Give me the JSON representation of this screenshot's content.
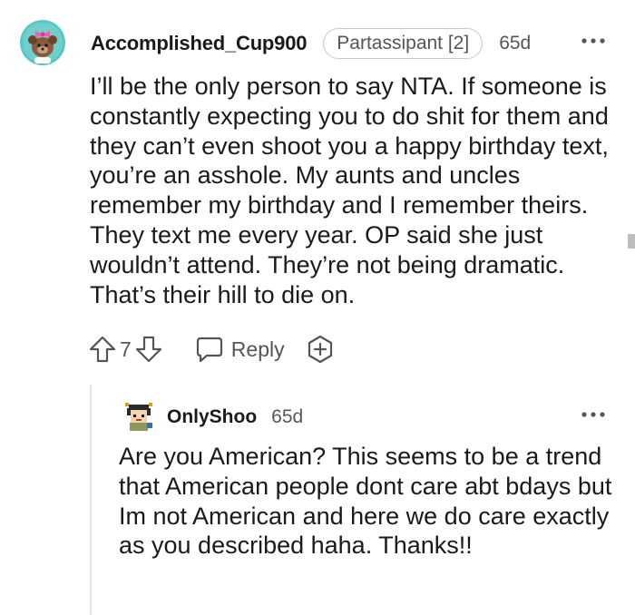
{
  "comment": {
    "username": "Accomplished_Cup900",
    "flair": "Partassipant [2]",
    "age": "65d",
    "avatar_icon": "avatar-pink-bow-icon",
    "body": "I’ll be the only person to say NTA. If someone is constantly expecting you to do shit for them and they can’t even shoot you a happy birthday text, you’re an asshole. My aunts and uncles remember my birthday and I remember theirs. They text me every year. OP said she just wouldn’t attend. They’re not being dramatic. That’s their hill to die on.",
    "vote_count": "7",
    "reply_label": "Reply",
    "more_icon": "more-options-icon"
  },
  "reply": {
    "username": "OnlyShoo",
    "age": "65d",
    "avatar_icon": "avatar-pixel-character-icon",
    "body": "Are you American? This seems to be a trend that American people dont care abt bdays but Im not American and here we do care exactly as you described haha. Thanks!!",
    "more_icon": "more-options-icon"
  },
  "colors": {
    "text": "#1a1a1b",
    "meta": "#555555",
    "flair_border": "#c9c9c9",
    "thread_line": "#e4e4e4",
    "avatar_bg": "#59c6c3",
    "avatar_bow": "#ff5aa5"
  }
}
